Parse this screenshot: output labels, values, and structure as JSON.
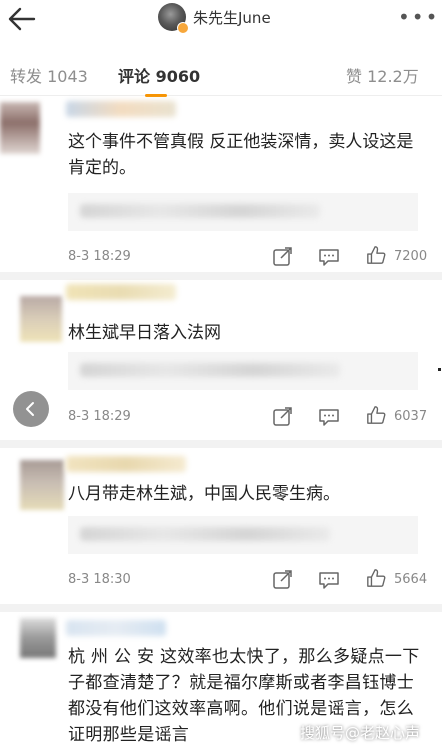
{
  "header": {
    "username": "朱先生June",
    "back_icon": "back-arrow-icon",
    "more_icon": "more-dots-icon",
    "badge_color": "#f7a73b"
  },
  "tabs": [
    {
      "label": "转发 1043",
      "active": false
    },
    {
      "label": "评论 9060",
      "active": true
    },
    {
      "label": "赞 12.2万",
      "active": false
    }
  ],
  "accent_color": "#f79400",
  "comments": [
    {
      "text": "这个事件不管真假 反正他装深情，卖人设这是肯定的。",
      "time": "8-3 18:29",
      "likes": "7200"
    },
    {
      "text": "林生斌早日落入法网",
      "time": "8-3 18:29",
      "likes": "6037"
    },
    {
      "text": "八月带走林生斌，中国人民零生病。",
      "time": "8-3 18:30",
      "likes": "5664"
    },
    {
      "text": "杭 州 公 安 这效率也太快了，那么多疑点一下子都查清楚了？就是福尔摩斯或者李昌钰博士都没有他们这效率高啊。他们说是谣言，怎么证明那些是谣言"
    }
  ],
  "actions": {
    "share_icon": "share-icon",
    "comment_icon": "comment-icon",
    "like_icon": "thumbs-up-icon"
  },
  "watermark": "搜狐号@老赵心声"
}
